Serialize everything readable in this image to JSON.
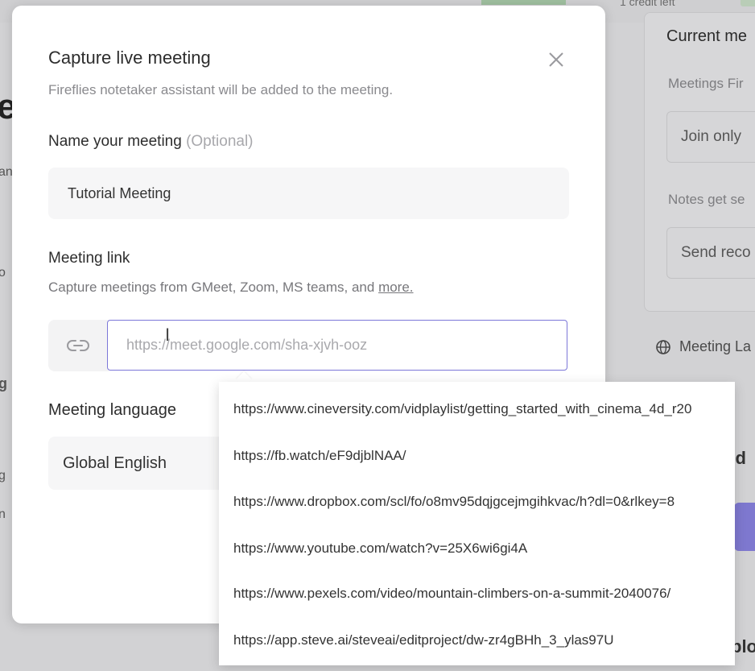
{
  "background": {
    "credit_text": "1 credit left",
    "panel_title": "Current me",
    "label_1": "Meetings Fir",
    "field_1": "Join only",
    "label_2": "Notes get se",
    "field_2": "Send reco",
    "meeting_lang": "Meeting La",
    "add_text": "dd",
    "bottom_text": "plo",
    "left_big": "e",
    "left_fragments": [
      "an",
      "o",
      "g l",
      "g",
      "n"
    ]
  },
  "modal": {
    "title": "Capture live meeting",
    "subtitle": "Fireflies notetaker assistant will be added to the meeting.",
    "name_label": "Name your meeting",
    "name_optional": "(Optional)",
    "name_value": "Tutorial Meeting",
    "link_label": "Meeting link",
    "link_sub": "Capture meetings from GMeet, Zoom, MS teams, and",
    "link_more": "more.",
    "link_placeholder": "https://meet.google.com/sha-xjvh-ooz",
    "lang_label": "Meeting language",
    "lang_value": "Global English"
  },
  "suggestions": [
    "https://www.cineversity.com/vidplaylist/getting_started_with_cinema_4d_r20",
    "https://fb.watch/eF9djblNAA/",
    "https://www.dropbox.com/scl/fo/o8mv95dqjgcejmgihkvac/h?dl=0&rlkey=8",
    "https://www.youtube.com/watch?v=25X6wi6gi4A",
    "https://www.pexels.com/video/mountain-climbers-on-a-summit-2040076/",
    "https://app.steve.ai/steveai/editproject/dw-zr4gBHh_3_ylas97U"
  ],
  "icons": {
    "close": "close-icon",
    "link": "link-icon",
    "globe": "globe-icon"
  }
}
